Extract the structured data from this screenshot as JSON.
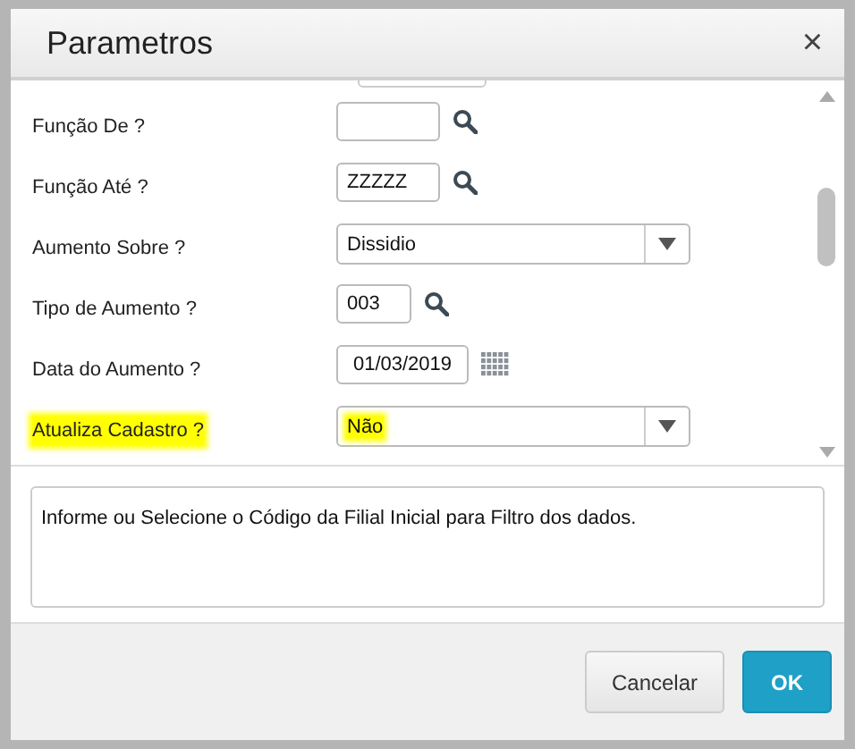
{
  "dialog": {
    "title": "Parametros",
    "close": "×"
  },
  "fields": [
    {
      "kind": "clipped"
    },
    {
      "kind": "lookup",
      "label": "Função De ?",
      "highlighted": false
    },
    {
      "kind": "lookup",
      "label": "Função Até ?",
      "value": "ZZZZZ",
      "highlighted": false
    },
    {
      "kind": "select",
      "label": "Aumento Sobre ?",
      "value": "Dissidio",
      "highlighted": false
    },
    {
      "kind": "lookup-short",
      "label": "Tipo de Aumento ?",
      "value": "003",
      "highlighted": false
    },
    {
      "kind": "date",
      "label": "Data do Aumento ?",
      "value": "01/03/2019",
      "highlighted": false
    },
    {
      "kind": "select",
      "label": "Atualiza Cadastro ?",
      "value": "Não",
      "highlighted": true
    }
  ],
  "help_text": "Informe ou Selecione o Código da Filial Inicial para Filtro dos dados.",
  "buttons": [
    {
      "label": "Cancelar",
      "kind": "secondary"
    },
    {
      "label": "OK",
      "kind": "primary"
    }
  ]
}
